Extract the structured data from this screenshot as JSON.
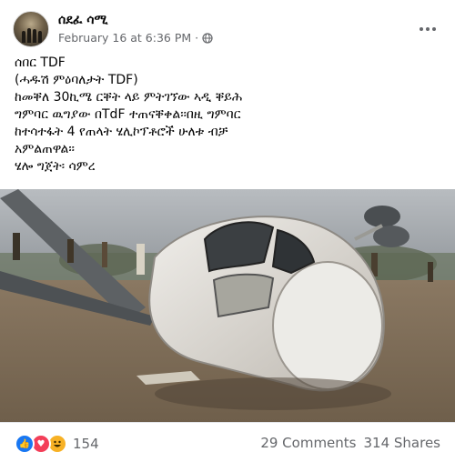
{
  "post": {
    "page_name": "ሰደፈ ሳሚ",
    "date": "February 16 at 6:36 PM",
    "separator": "·",
    "privacy_icon": "globe-icon",
    "more_icon": "more-options-icon",
    "text_lines": [
      "ሰበር TDF",
      "(ሓዱሽ ምዕባለታት TDF)",
      " ከመቐለ 30ኪሜ ርቐት ላይ ምትገኘው ኣዲ ቐይሕ",
      "ግምባር ዉግያው በTdF ተጠናቐቀል፡፡በዚ ግምባር",
      "ከተሳተፋት 4 የጠላት ሄሊኮፕቶሮች ሁለቱ ብቻ",
      "አምልጠዋል፡፡",
      "ሄሎ ግጀት፡ ሳምረ"
    ]
  },
  "footer": {
    "reaction_icons": [
      "like-icon",
      "love-icon",
      "haha-icon"
    ],
    "reaction_count": "154",
    "comments": "29 Comments",
    "shares": "314 Shares"
  },
  "colors": {
    "secondary_text": "#65676b",
    "like": "#1877f2",
    "love": "#f33e58",
    "haha": "#f7b125"
  }
}
